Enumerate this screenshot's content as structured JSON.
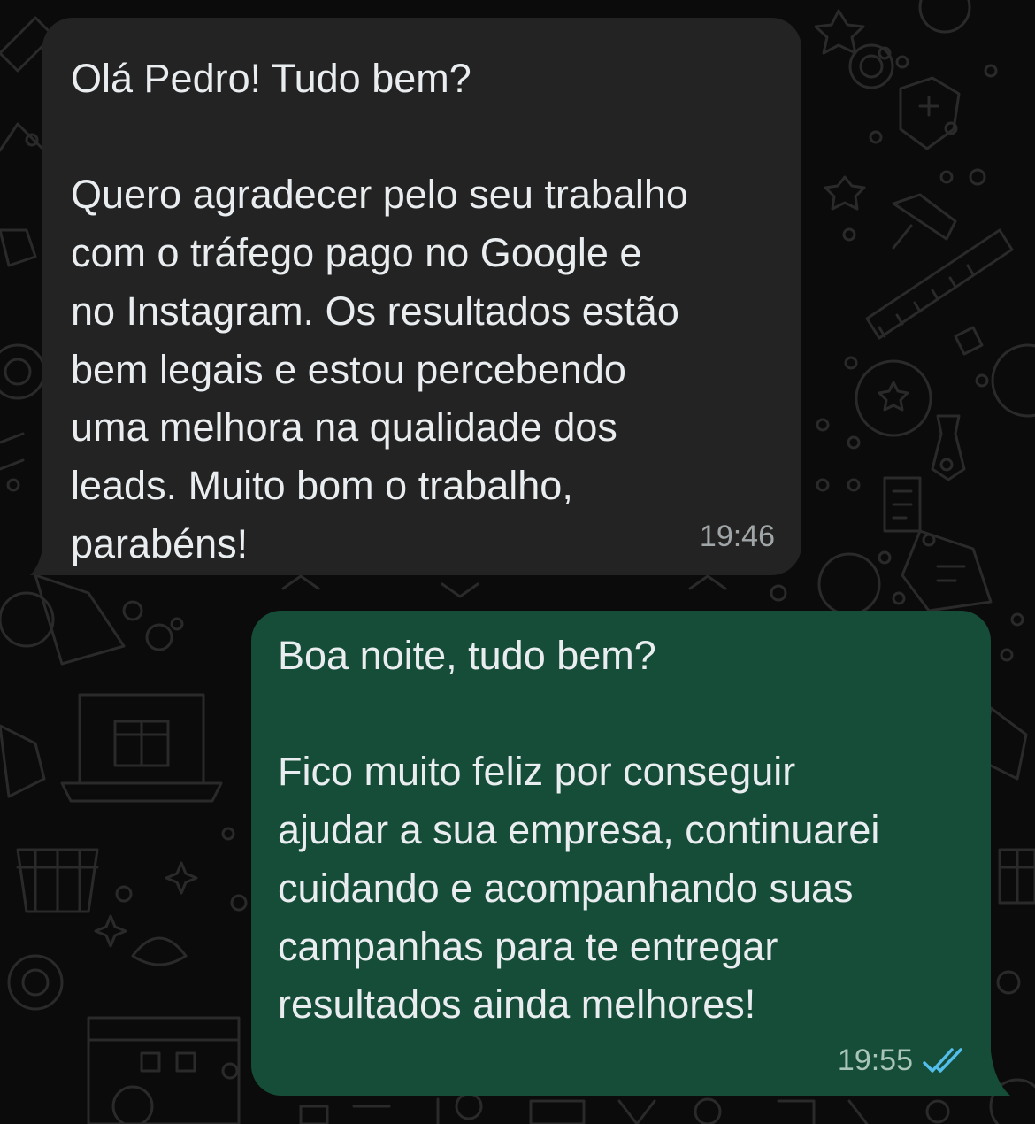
{
  "chat": {
    "messages": [
      {
        "direction": "incoming",
        "text": "Olá Pedro! Tudo bem?\n\nQuero agradecer pelo seu trabalho\ncom o tráfego pago no Google e\nno Instagram. Os resultados estão\nbem legais e estou percebendo\numa melhora na qualidade dos\nleads. Muito bom o trabalho,\nparabéns!",
        "time": "19:46"
      },
      {
        "direction": "outgoing",
        "text": "Boa noite, tudo bem?\n\nFico muito feliz por conseguir\najudar a sua empresa, continuarei\ncuidando e acompanhando suas\ncampanhas para te entregar\nresultados ainda melhores!",
        "time": "19:55",
        "status_icon": "double-check-read-icon"
      }
    ]
  },
  "colors": {
    "background": "#0b0b0b",
    "incoming_bubble": "#232323",
    "outgoing_bubble": "#164d38",
    "text": "#e9edef",
    "read_check": "#53bdeb"
  }
}
